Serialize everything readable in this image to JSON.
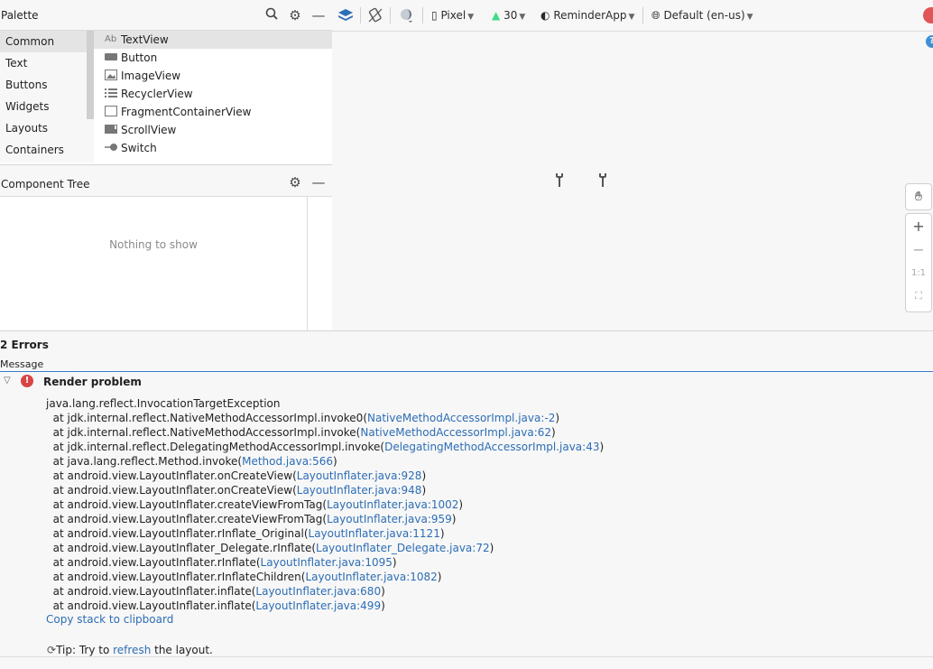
{
  "palette": {
    "title": "Palette",
    "categories": [
      "Common",
      "Text",
      "Buttons",
      "Widgets",
      "Layouts",
      "Containers"
    ],
    "widgets": [
      {
        "label": "TextView",
        "icon": "Ab"
      },
      {
        "label": "Button",
        "icon": ""
      },
      {
        "label": "ImageView",
        "icon": ""
      },
      {
        "label": "RecyclerView",
        "icon": ""
      },
      {
        "label": "FragmentContainerView",
        "icon": ""
      },
      {
        "label": "ScrollView",
        "icon": ""
      },
      {
        "label": "Switch",
        "icon": ""
      }
    ]
  },
  "component_tree": {
    "title": "Component Tree",
    "empty_text": "Nothing to show"
  },
  "toolbar": {
    "device": "Pixel",
    "api_level": "30",
    "theme": "ReminderApp",
    "locale": "Default (en-us)"
  },
  "errors": {
    "count_title": "2 Errors",
    "column_header": "Message",
    "render_title": "Render problem",
    "exception": "java.lang.reflect.InvocationTargetException",
    "stack": [
      {
        "text": "  at jdk.internal.reflect.NativeMethodAccessorImpl.invoke0(",
        "link": "NativeMethodAccessorImpl.java:-2",
        "end": ")"
      },
      {
        "text": "  at jdk.internal.reflect.NativeMethodAccessorImpl.invoke(",
        "link": "NativeMethodAccessorImpl.java:62",
        "end": ")"
      },
      {
        "text": "  at jdk.internal.reflect.DelegatingMethodAccessorImpl.invoke(",
        "link": "DelegatingMethodAccessorImpl.java:43",
        "end": ")"
      },
      {
        "text": "  at java.lang.reflect.Method.invoke(",
        "link": "Method.java:566",
        "end": ")"
      },
      {
        "text": "  at android.view.LayoutInflater.onCreateView(",
        "link": "LayoutInflater.java:928",
        "end": ")"
      },
      {
        "text": "  at android.view.LayoutInflater.onCreateView(",
        "link": "LayoutInflater.java:948",
        "end": ")"
      },
      {
        "text": "  at android.view.LayoutInflater.createViewFromTag(",
        "link": "LayoutInflater.java:1002",
        "end": ")"
      },
      {
        "text": "  at android.view.LayoutInflater.createViewFromTag(",
        "link": "LayoutInflater.java:959",
        "end": ")"
      },
      {
        "text": "  at android.view.LayoutInflater.rInflate_Original(",
        "link": "LayoutInflater.java:1121",
        "end": ")"
      },
      {
        "text": "  at android.view.LayoutInflater_Delegate.rInflate(",
        "link": "LayoutInflater_Delegate.java:72",
        "end": ")"
      },
      {
        "text": "  at android.view.LayoutInflater.rInflate(",
        "link": "LayoutInflater.java:1095",
        "end": ")"
      },
      {
        "text": "  at android.view.LayoutInflater.rInflateChildren(",
        "link": "LayoutInflater.java:1082",
        "end": ")"
      },
      {
        "text": "  at android.view.LayoutInflater.inflate(",
        "link": "LayoutInflater.java:680",
        "end": ")"
      },
      {
        "text": "  at android.view.LayoutInflater.inflate(",
        "link": "LayoutInflater.java:499",
        "end": ")"
      }
    ],
    "copy_link": "Copy stack to clipboard",
    "tip_prefix": "Tip: Try to ",
    "tip_link": "refresh",
    "tip_suffix": " the layout."
  },
  "icons": {
    "search": "search-icon",
    "gear": "gear-icon",
    "minimize": "minimize-icon",
    "layers": "layers-icon",
    "rotate": "orientation-icon",
    "night": "night-mode-icon",
    "phone": "phone-icon",
    "android": "android-icon",
    "palette": "theme-icon",
    "globe": "globe-icon",
    "hand": "pan-hand-icon",
    "help": "help-icon",
    "error": "error-icon"
  },
  "colors": {
    "accent": "#2d6db5",
    "error": "#d94444",
    "android_green": "#3ddc84"
  }
}
